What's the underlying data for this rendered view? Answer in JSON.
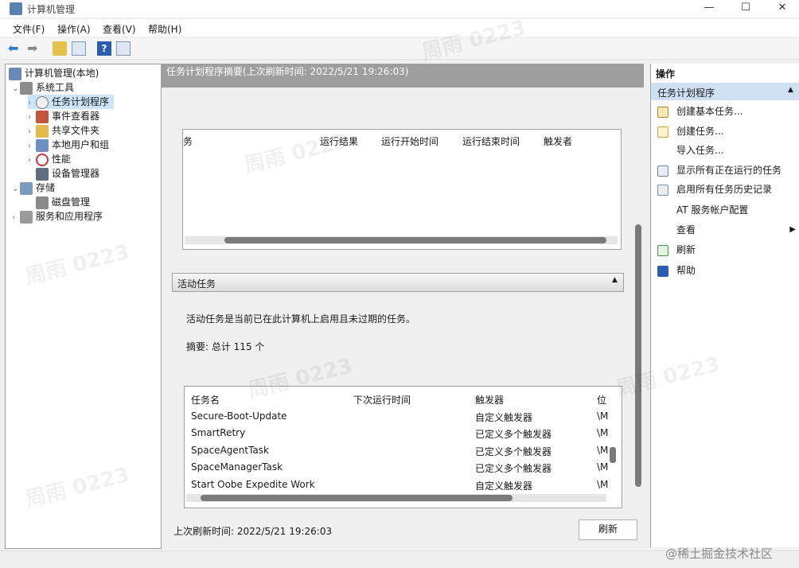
{
  "window": {
    "title": "计算机管理",
    "controls": [
      "—",
      "☐",
      "✕"
    ]
  },
  "menu": [
    "文件(F)",
    "操作(A)",
    "查看(V)",
    "帮助(H)"
  ],
  "tree": {
    "root": "计算机管理(本地)",
    "system_tools": "系统工具",
    "task_scheduler": "任务计划程序",
    "event_viewer": "事件查看器",
    "shared_folders": "共享文件夹",
    "local_users": "本地用户和组",
    "performance": "性能",
    "device_manager": "设备管理器",
    "storage": "存储",
    "disk_mgmt": "磁盘管理",
    "services_apps": "服务和应用程序"
  },
  "middle": {
    "header": "任务计划程序摘要(上次刷新时间: 2022/5/21 19:26:03)",
    "top_grid_headers": [
      "务",
      "运行结果",
      "运行开始时间",
      "运行结束时间",
      "触发者"
    ],
    "active_section": "活动任务",
    "active_desc": "活动任务是当前已在此计算机上启用且未过期的任务。",
    "summary": "摘要: 总计 115 个",
    "task_headers": [
      "任务名",
      "下次运行时间",
      "触发器",
      "位"
    ],
    "tasks": [
      {
        "name": "Secure-Boot-Update",
        "next": "",
        "trigger": "自定义触发器",
        "loc": "\\M"
      },
      {
        "name": "SmartRetry",
        "next": "",
        "trigger": "已定义多个触发器",
        "loc": "\\M"
      },
      {
        "name": "SpaceAgentTask",
        "next": "",
        "trigger": "已定义多个触发器",
        "loc": "\\M"
      },
      {
        "name": "SpaceManagerTask",
        "next": "",
        "trigger": "已定义多个触发器",
        "loc": "\\M"
      },
      {
        "name": "Start Oobe Expedite Work",
        "next": "",
        "trigger": "自定义触发器",
        "loc": "\\M"
      }
    ],
    "last_refresh": "上次刷新时间: 2022/5/21 19:26:03",
    "refresh_button": "刷新"
  },
  "actions": {
    "header": "操作",
    "group": "任务计划程序",
    "items": [
      "创建基本任务...",
      "创建任务...",
      "导入任务...",
      "显示所有正在运行的任务",
      "启用所有任务历史记录",
      "AT 服务帐户配置",
      "查看",
      "刷新",
      "帮助"
    ]
  },
  "watermark": "@稀土掘金技术社区",
  "bg_watermark": "周雨 0223",
  "colors": {
    "selection": "#cce4f7",
    "header_gray": "#9e9e9e",
    "action_group": "#cfe0f2"
  }
}
